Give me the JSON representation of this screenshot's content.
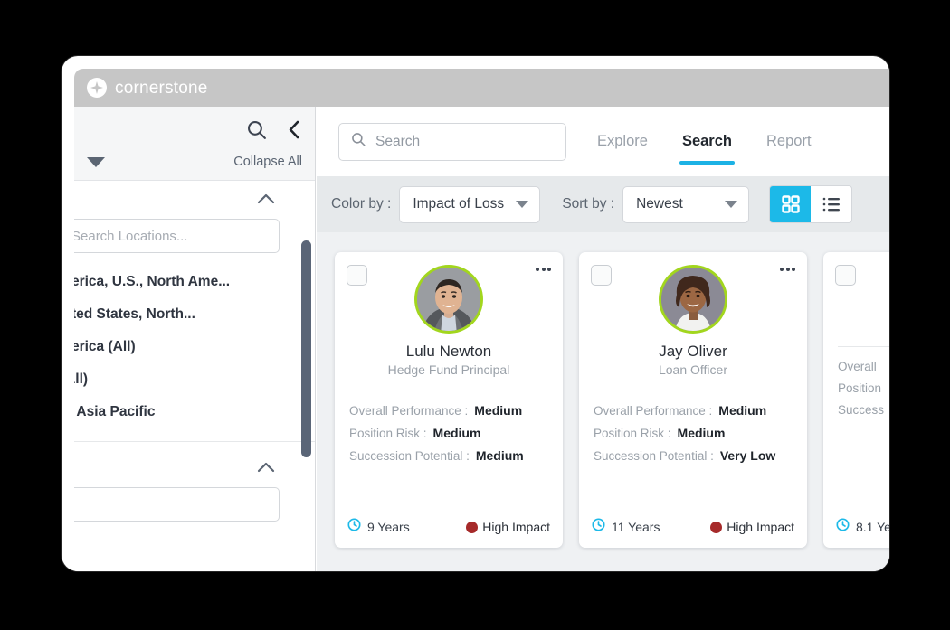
{
  "brand": {
    "name": "cornerstone",
    "logo_icon": "cornerstone-star-icon",
    "bar_color": "#c6c6c6"
  },
  "theme": {
    "accent_cyan": "#1cb9e8",
    "tab_underline": "#1cb2e5",
    "avatar_ring_green": "#a2d61e",
    "high_impact_red": "#a62a2a",
    "content_bg": "#eff1f3",
    "controls_bg": "#e6e9eb",
    "scrollbar_thumb": "#5a6577"
  },
  "sidebar": {
    "search_icon": "search-icon",
    "collapse_panel_icon": "chevron-left-icon",
    "expand_caret_icon": "caret-down-icon",
    "collapse_all_label": "Collapse All",
    "sections": [
      {
        "collapse_icon": "chevron-up-icon",
        "search_placeholder": "Search Locations...",
        "search_value": "",
        "items": [
          "America, U.S., North Ame...",
          "United States, North...",
          "America (All)",
          "c (All)",
          "ina, Asia Pacific"
        ]
      },
      {
        "collapse_icon": "chevron-up-icon",
        "search_placeholder": "",
        "search_value": "",
        "items": []
      }
    ],
    "scrollbar": {
      "visible": true
    }
  },
  "main": {
    "search": {
      "placeholder": "Search",
      "value": "",
      "icon": "search-icon"
    },
    "tabs": [
      {
        "label": "Explore",
        "active": false
      },
      {
        "label": "Search",
        "active": true
      },
      {
        "label": "Report",
        "active": false
      }
    ],
    "controls": {
      "color_by_label": "Color by :",
      "color_by_value": "Impact of Loss",
      "sort_by_label": "Sort by :",
      "sort_by_value": "Newest",
      "view_grid_icon": "grid-view-icon",
      "view_list_icon": "list-view-icon",
      "view_active": "grid"
    },
    "attribute_labels": {
      "overall_performance": "Overall Performance :",
      "position_risk": "Position Risk :",
      "succession_potential": "Succession Potential :"
    },
    "cards": [
      {
        "name": "Lulu Newton",
        "title": "Hedge Fund Principal",
        "avatar_ring": "#a2d61e",
        "avatar_icon": "person-photo-male",
        "checkbox_checked": false,
        "menu_icon": "more-options-icon",
        "overall_performance": "Medium",
        "position_risk": "Medium",
        "succession_potential": "Medium",
        "tenure": "9 Years",
        "tenure_icon": "clock-icon",
        "impact": "High Impact",
        "impact_color": "#a62a2a",
        "truncated": false
      },
      {
        "name": "Jay Oliver",
        "title": "Loan Officer",
        "avatar_ring": "#a2d61e",
        "avatar_icon": "person-photo-female",
        "checkbox_checked": false,
        "menu_icon": "more-options-icon",
        "overall_performance": "Medium",
        "position_risk": "Medium",
        "succession_potential": "Very Low",
        "tenure": "11 Years",
        "tenure_icon": "clock-icon",
        "impact": "High Impact",
        "impact_color": "#a62a2a",
        "truncated": false
      },
      {
        "name": "",
        "title": "",
        "avatar_ring": "#a2d61e",
        "avatar_icon": "person-photo",
        "checkbox_checked": false,
        "menu_icon": "more-options-icon",
        "overall_performance": "",
        "position_risk": "",
        "succession_potential": "",
        "tenure": "8.1 Ye",
        "tenure_icon": "clock-icon",
        "impact": "",
        "impact_color": "#a62a2a",
        "truncated": true,
        "label_overall": "Overall",
        "label_position": "Position",
        "label_succession": "Success"
      }
    ]
  }
}
